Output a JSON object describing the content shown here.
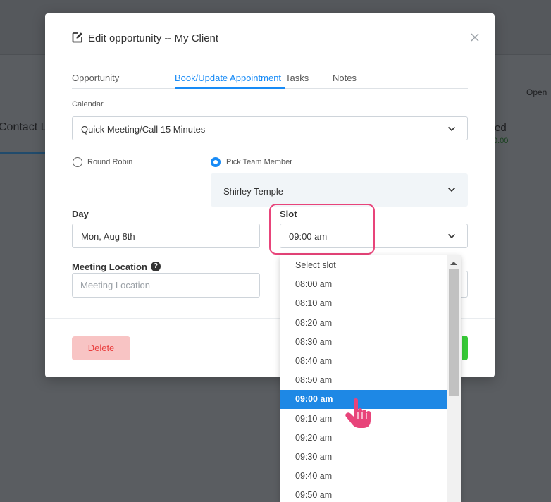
{
  "background": {
    "open_label": "Open",
    "contact_label": "Contact Lo",
    "status_fragment": "ed",
    "amount_fragment": "0.00"
  },
  "modal": {
    "title": "Edit opportunity -- My Client",
    "tabs": [
      {
        "label": "Opportunity",
        "active": false
      },
      {
        "label": "Book/Update Appointment",
        "active": true
      },
      {
        "label": "Tasks",
        "active": false
      },
      {
        "label": "Notes",
        "active": false
      }
    ],
    "calendar": {
      "label": "Calendar",
      "value": "Quick Meeting/Call 15 Minutes"
    },
    "assignment": {
      "round_robin_label": "Round Robin",
      "pick_team_member_label": "Pick Team Member",
      "selected": "Pick Team Member",
      "team_member": "Shirley Temple"
    },
    "day": {
      "label": "Day",
      "value": "Mon, Aug 8th"
    },
    "slot": {
      "label": "Slot",
      "value": "09:00 am"
    },
    "meeting_location": {
      "label": "Meeting Location",
      "help_icon": "?",
      "placeholder": "Meeting Location"
    },
    "delete_label": "Delete"
  },
  "slot_dropdown": {
    "selected": "09:00 am",
    "options": [
      "Select slot",
      "08:00 am",
      "08:10 am",
      "08:20 am",
      "08:30 am",
      "08:40 am",
      "08:50 am",
      "09:00 am",
      "09:10 am",
      "09:20 am",
      "09:30 am",
      "09:40 am",
      "09:50 am"
    ]
  },
  "colors": {
    "accent": "#188bf6",
    "highlight_ring": "#e8447a",
    "delete_bg": "#f8c4c4",
    "delete_text": "#e93d3d"
  }
}
